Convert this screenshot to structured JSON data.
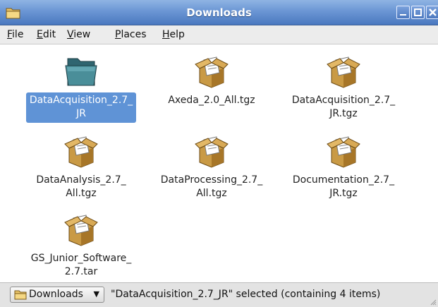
{
  "window": {
    "title": "Downloads",
    "controls": [
      "minimize",
      "maximize",
      "close"
    ]
  },
  "menubar": [
    {
      "accel": "F",
      "rest": "ile"
    },
    {
      "accel": "E",
      "rest": "dit"
    },
    {
      "accel": "V",
      "rest": "iew"
    },
    {
      "accel": "P",
      "rest": "laces"
    },
    {
      "accel": "H",
      "rest": "elp"
    }
  ],
  "files": [
    {
      "line1": "DataAcquisition_2.7_",
      "line2": "JR",
      "icon": "folder-icon",
      "selected": true
    },
    {
      "line1": "Axeda_2.0_All.tgz",
      "line2": "",
      "icon": "package-icon",
      "selected": false
    },
    {
      "line1": "DataAcquisition_2.7_",
      "line2": "JR.tgz",
      "icon": "package-icon",
      "selected": false
    },
    {
      "line1": "DataAnalysis_2.7_",
      "line2": "All.tgz",
      "icon": "package-icon",
      "selected": false
    },
    {
      "line1": "DataProcessing_2.7_",
      "line2": "All.tgz",
      "icon": "package-icon",
      "selected": false
    },
    {
      "line1": "Documentation_2.7_",
      "line2": "JR.tgz",
      "icon": "package-icon",
      "selected": false
    },
    {
      "line1": "GS_Junior_Software_",
      "line2": "2.7.tar",
      "icon": "package-icon",
      "selected": false
    }
  ],
  "statusbar": {
    "location": "Downloads",
    "status": "\"DataAcquisition_2.7_JR\" selected (containing 4 items)"
  },
  "colors": {
    "titlebar": "#6b96d4",
    "selection": "#5f93d6",
    "folder": "#3f7f86",
    "package": "#c99a45"
  }
}
